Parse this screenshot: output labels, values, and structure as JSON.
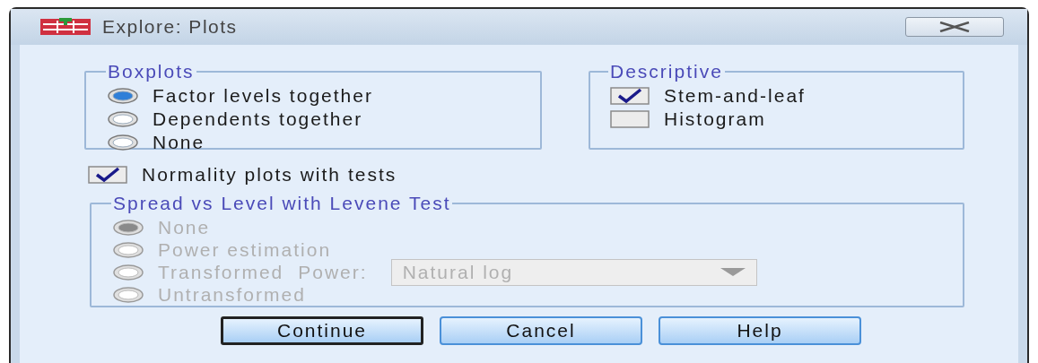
{
  "window": {
    "title": "Explore: Plots"
  },
  "boxplots": {
    "title": "Boxplots",
    "options": [
      {
        "label": "Factor levels together",
        "selected": true
      },
      {
        "label": "Dependents together",
        "selected": false
      },
      {
        "label": "None",
        "selected": false
      }
    ]
  },
  "descriptive": {
    "title": "Descriptive",
    "options": [
      {
        "label": "Stem-and-leaf",
        "checked": true
      },
      {
        "label": "Histogram",
        "checked": false
      }
    ]
  },
  "normality": {
    "label": "Normality plots with tests",
    "checked": true
  },
  "spread": {
    "title": "Spread vs Level with Levene Test",
    "disabled": true,
    "options": [
      {
        "label": "None",
        "selected": true
      },
      {
        "label": "Power estimation",
        "selected": false
      },
      {
        "label": "Transformed",
        "selected": false
      },
      {
        "label": "Untransformed",
        "selected": false
      }
    ],
    "power_label": "Power:",
    "power_value": "Natural log"
  },
  "buttons": [
    {
      "label": "Continue",
      "default": true
    },
    {
      "label": "Cancel",
      "default": false
    },
    {
      "label": "Help",
      "default": false
    }
  ]
}
